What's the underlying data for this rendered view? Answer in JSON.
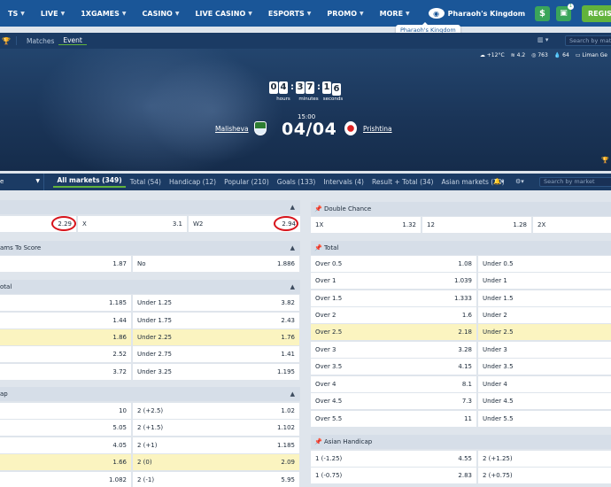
{
  "topnav": {
    "items": [
      {
        "label": "TS"
      },
      {
        "label": "LIVE"
      },
      {
        "label": "1XGAMES"
      },
      {
        "label": "CASINO"
      },
      {
        "label": "LIVE CASINO"
      },
      {
        "label": "ESPORTS"
      },
      {
        "label": "PROMO"
      },
      {
        "label": "MORE"
      }
    ],
    "featured": "Pharaoh's Kingdom",
    "tooltip": "Pharaoh's Kingdom",
    "register": "REGIS",
    "gift_badge": "1"
  },
  "subnav": {
    "tabs": [
      "Matches",
      "Event"
    ],
    "active_tab": "Event",
    "search_placeholder": "Search by matc"
  },
  "weather": {
    "temp": "+12°C",
    "wind": "4.2",
    "pressure": "763",
    "humidity": "64",
    "venue": "Liman Ge"
  },
  "match": {
    "countdown": {
      "digits": [
        "0",
        "4",
        "3",
        "7",
        "1",
        "6"
      ],
      "labels": [
        "hours",
        "minutes",
        "seconds"
      ]
    },
    "kickoff": "15:00",
    "date": "04/04",
    "home": "Malisheva",
    "away": "Prishtina"
  },
  "markets_bar": {
    "select": "e",
    "tabs": [
      "All markets (349)",
      "Total (54)",
      "Handicap (12)",
      "Popular (210)",
      "Goals (133)",
      "Intervals (4)",
      "Result + Total (34)",
      "Asian markets (20)"
    ],
    "search_placeholder": "Search by market"
  },
  "left": {
    "result_row": [
      {
        "label": "",
        "value": "2.29"
      },
      {
        "label": "X",
        "value": "3.1"
      },
      {
        "label": "W2",
        "value": "2.94"
      }
    ],
    "bts": {
      "title": "ams To Score",
      "rows": [
        [
          {
            "label": "",
            "value": "1.87"
          },
          {
            "label": "No",
            "value": "1.886"
          }
        ]
      ]
    },
    "total": {
      "title": "otal",
      "rows": [
        [
          {
            "label": "",
            "value": "1.185"
          },
          {
            "label": "Under 1.25",
            "value": "3.82"
          }
        ],
        [
          {
            "label": "",
            "value": "1.44"
          },
          {
            "label": "Under 1.75",
            "value": "2.43"
          }
        ],
        [
          {
            "label": "",
            "value": "1.86"
          },
          {
            "label": "Under 2.25",
            "value": "1.76"
          }
        ],
        [
          {
            "label": "",
            "value": "2.52"
          },
          {
            "label": "Under 2.75",
            "value": "1.41"
          }
        ],
        [
          {
            "label": "",
            "value": "3.72"
          },
          {
            "label": "Under 3.25",
            "value": "1.195"
          }
        ]
      ]
    },
    "handicap": {
      "title": "ap",
      "rows": [
        [
          {
            "label": "",
            "value": "10"
          },
          {
            "label": "2 (+2.5)",
            "value": "1.02"
          }
        ],
        [
          {
            "label": "",
            "value": "5.05"
          },
          {
            "label": "2 (+1.5)",
            "value": "1.102"
          }
        ],
        [
          {
            "label": "",
            "value": "4.05"
          },
          {
            "label": "2 (+1)",
            "value": "1.185"
          }
        ],
        [
          {
            "label": "",
            "value": "1.66"
          },
          {
            "label": "2 (0)",
            "value": "2.09"
          }
        ],
        [
          {
            "label": "",
            "value": "1.082"
          },
          {
            "label": "2 (-1)",
            "value": "5.95"
          }
        ]
      ]
    }
  },
  "right": {
    "double_chance": {
      "title": "Double Chance",
      "row": [
        {
          "label": "1X",
          "value": "1.32"
        },
        {
          "label": "12",
          "value": "1.28"
        },
        {
          "label": "2X",
          "value": ""
        }
      ]
    },
    "total": {
      "title": "Total",
      "rows": [
        [
          {
            "label": "Over 0.5",
            "value": "1.08"
          },
          {
            "label": "Under 0.5",
            "value": ""
          }
        ],
        [
          {
            "label": "Over 1",
            "value": "1.039"
          },
          {
            "label": "Under 1",
            "value": ""
          }
        ],
        [
          {
            "label": "Over 1.5",
            "value": "1.333"
          },
          {
            "label": "Under 1.5",
            "value": ""
          }
        ],
        [
          {
            "label": "Over 2",
            "value": "1.6"
          },
          {
            "label": "Under 2",
            "value": ""
          }
        ],
        [
          {
            "label": "Over 2.5",
            "value": "2.18"
          },
          {
            "label": "Under 2.5",
            "value": ""
          }
        ],
        [
          {
            "label": "Over 3",
            "value": "3.28"
          },
          {
            "label": "Under 3",
            "value": ""
          }
        ],
        [
          {
            "label": "Over 3.5",
            "value": "4.15"
          },
          {
            "label": "Under 3.5",
            "value": ""
          }
        ],
        [
          {
            "label": "Over 4",
            "value": "8.1"
          },
          {
            "label": "Under 4",
            "value": ""
          }
        ],
        [
          {
            "label": "Over 4.5",
            "value": "7.3"
          },
          {
            "label": "Under 4.5",
            "value": ""
          }
        ],
        [
          {
            "label": "Over 5.5",
            "value": "11"
          },
          {
            "label": "Under 5.5",
            "value": ""
          }
        ]
      ]
    },
    "asian": {
      "title": "Asian Handicap",
      "rows": [
        [
          {
            "label": "1 (-1.25)",
            "value": "4.55"
          },
          {
            "label": "2 (+1.25)",
            "value": ""
          }
        ],
        [
          {
            "label": "1 (-0.75)",
            "value": "2.83"
          },
          {
            "label": "2 (+0.75)",
            "value": ""
          }
        ]
      ]
    }
  },
  "colors": {
    "nav": "#1a5698",
    "subnav": "#1b3b64",
    "accent_green": "#62b33c",
    "highlight": "#fbf4c0",
    "circle": "#d8141c"
  }
}
